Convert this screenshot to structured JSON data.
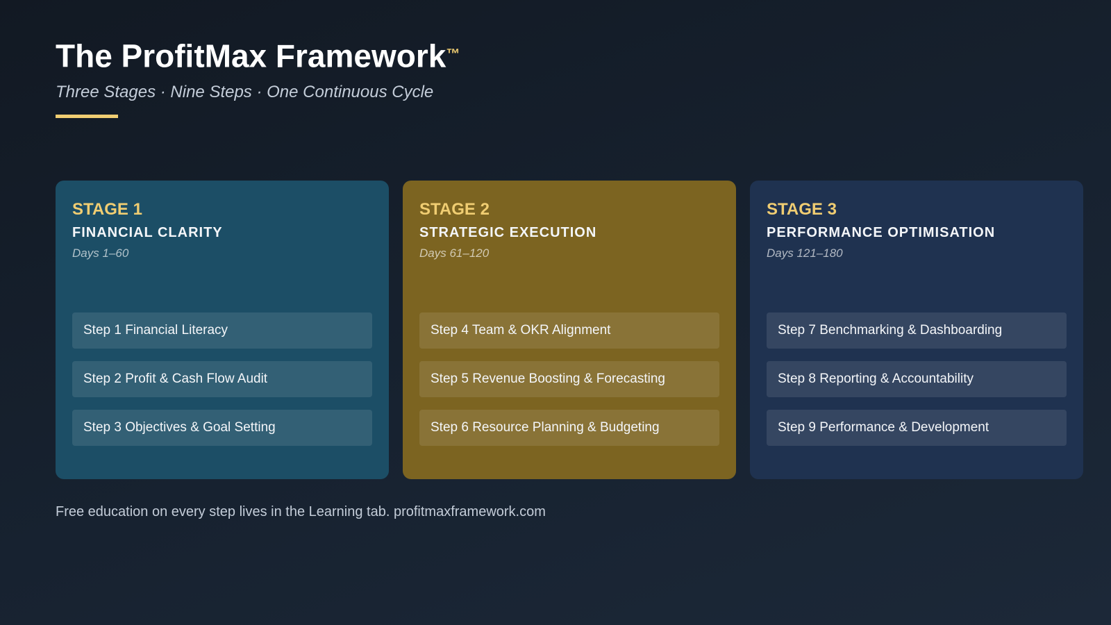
{
  "header": {
    "title": "The ProfitMax Framework",
    "trademark": "™",
    "subtitle": "Three Stages · Nine Steps · One Continuous Cycle"
  },
  "colors": {
    "accent": "#f0cd72",
    "stage1_bg": "#1c4e66",
    "stage2_bg": "#7c6421",
    "stage3_bg": "#1f3250",
    "page_bg": "#151e2a"
  },
  "stages": [
    {
      "number_label": "STAGE 1",
      "name": "FINANCIAL CLARITY",
      "days": "Days 1–60",
      "steps": [
        "Step 1 Financial Literacy",
        "Step 2 Profit & Cash Flow Audit",
        "Step 3 Objectives & Goal Setting"
      ]
    },
    {
      "number_label": "STAGE 2",
      "name": "STRATEGIC EXECUTION",
      "days": "Days 61–120",
      "steps": [
        "Step 4 Team & OKR Alignment",
        "Step 5 Revenue Boosting & Forecasting",
        "Step 6 Resource Planning & Budgeting"
      ]
    },
    {
      "number_label": "STAGE 3",
      "name": "PERFORMANCE OPTIMISATION",
      "days": "Days 121–180",
      "steps": [
        "Step 7 Benchmarking & Dashboarding",
        "Step 8 Reporting & Accountability",
        "Step 9 Performance & Development"
      ]
    }
  ],
  "footer": {
    "text": "Free education on every step lives in the Learning tab. profitmaxframework.com"
  }
}
